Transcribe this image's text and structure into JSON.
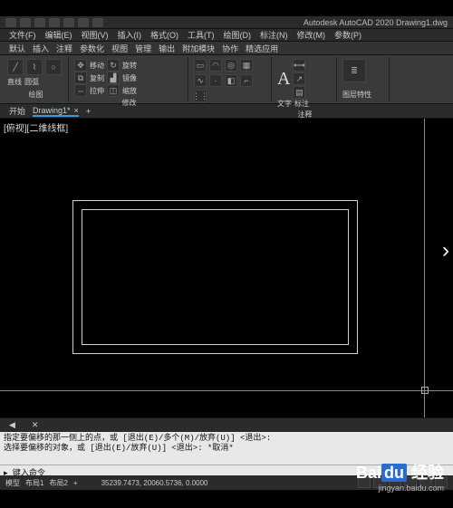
{
  "app": {
    "title": "Autodesk AutoCAD 2020   Drawing1.dwg"
  },
  "menubar": [
    "文件(F)",
    "编辑(E)",
    "视图(V)",
    "插入(I)",
    "格式(O)",
    "工具(T)",
    "绘图(D)",
    "标注(N)",
    "修改(M)",
    "参数(P)"
  ],
  "ribbonTabs": [
    "默认",
    "插入",
    "注释",
    "参数化",
    "视图",
    "管理",
    "输出",
    "附加模块",
    "协作",
    "精选应用"
  ],
  "panels": {
    "draw": {
      "label": "绘图",
      "items": [
        "直线",
        "圆弧"
      ]
    },
    "modify": {
      "label": "修改",
      "m1": "移动",
      "m2": "复制",
      "m3": "拉伸",
      "m4": "旋转",
      "m5": "镜像",
      "m6": "缩放"
    },
    "annotate": {
      "label": "注释",
      "text": "文字",
      "dim": "标注"
    },
    "layer": {
      "label": "图层",
      "btn": "图层特性"
    }
  },
  "docTabs": {
    "start": "开始",
    "active": "Drawing1*"
  },
  "viewLabel": "[俯视][二维线框]",
  "layoutTabs": {
    "close": "✕"
  },
  "cmd": {
    "line1": "指定要偏移的那一侧上的点，或 [退出(E)/多个(M)/放弃(U)] <退出>:",
    "line2": "选择要偏移的对象，或 [退出(E)/放弃(U)] <退出>:  *取消*",
    "prompt": "键入命令"
  },
  "status": {
    "tabs": [
      "模型",
      "布局1",
      "布局2"
    ],
    "coords": "35239.7473, 20060.5736, 0.0000"
  },
  "watermark": {
    "logo1": "Bai",
    "logo2": "du",
    "logo3": "经验",
    "url": "jingyan.baidu.com"
  },
  "nav": {
    "right": "›"
  }
}
